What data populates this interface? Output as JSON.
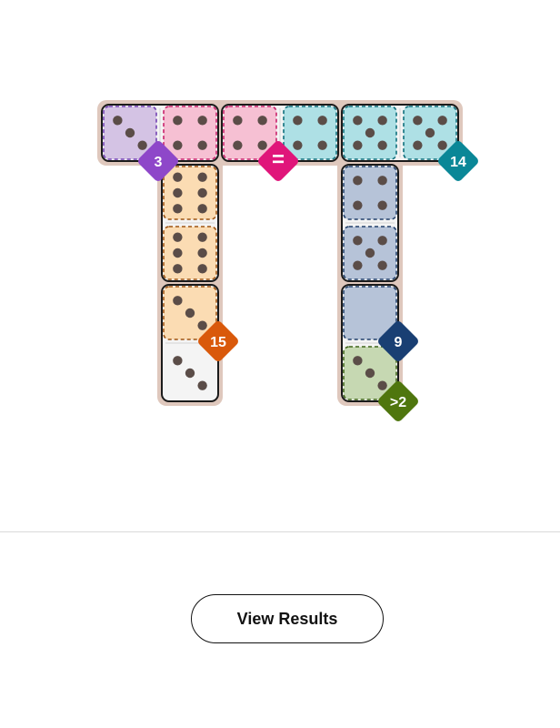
{
  "colors": {
    "tray": "#dfc8bd",
    "tile_border": "#1b1b1b",
    "pip": "#5b4d48",
    "regions": {
      "purple": {
        "fill": "#d4c3e4",
        "stroke": "#7342b3",
        "badge": "#8e47c9"
      },
      "pink": {
        "fill": "#f6c0d3",
        "stroke": "#c9226c",
        "badge": "#e0157a"
      },
      "cyan": {
        "fill": "#aee0e5",
        "stroke": "#0f6f7c",
        "badge": "#0a8797"
      },
      "orange": {
        "fill": "#fbdcb3",
        "stroke": "#9e5413",
        "badge": "#d9590b"
      },
      "slate": {
        "fill": "#b6c3d8",
        "stroke": "#22406b",
        "badge": "#193f73"
      },
      "green": {
        "fill": "#c6d8b2",
        "stroke": "#3f6419",
        "badge": "#4f760e"
      },
      "none": {
        "fill": "#f4f4f4",
        "stroke": "#1b1b1b",
        "badge": "#000000"
      }
    }
  },
  "board": {
    "cells": [
      {
        "id": "r0c0",
        "region": "purple",
        "pips": 3
      },
      {
        "id": "r0c1",
        "region": "pink",
        "pips": 4
      },
      {
        "id": "r0c2",
        "region": "pink",
        "pips": 4
      },
      {
        "id": "r0c3",
        "region": "cyan",
        "pips": 4
      },
      {
        "id": "r0c4",
        "region": "cyan",
        "pips": 5
      },
      {
        "id": "r0c5",
        "region": "cyan",
        "pips": 5
      },
      {
        "id": "r1c1",
        "region": "orange",
        "pips": 6
      },
      {
        "id": "r2c1",
        "region": "orange",
        "pips": 6
      },
      {
        "id": "r3c1",
        "region": "orange",
        "pips": 3
      },
      {
        "id": "r4c1",
        "region": "none",
        "pips": 3
      },
      {
        "id": "r1c4",
        "region": "slate",
        "pips": 4
      },
      {
        "id": "r2c4",
        "region": "slate",
        "pips": 5
      },
      {
        "id": "r3c4",
        "region": "slate",
        "pips": 0
      },
      {
        "id": "r4c4",
        "region": "green",
        "pips": 3
      }
    ],
    "dominoes": [
      {
        "name": "domino-top-left",
        "a": "r0c0",
        "b": "r0c1"
      },
      {
        "name": "domino-top-middle",
        "a": "r0c2",
        "b": "r0c3"
      },
      {
        "name": "domino-top-right",
        "a": "r0c4",
        "b": "r0c5"
      },
      {
        "name": "domino-left-upper",
        "a": "r1c1",
        "b": "r2c1"
      },
      {
        "name": "domino-left-lower",
        "a": "r3c1",
        "b": "r4c1"
      },
      {
        "name": "domino-right-upper",
        "a": "r1c4",
        "b": "r2c4"
      },
      {
        "name": "domino-right-lower",
        "a": "r3c4",
        "b": "r4c4"
      }
    ],
    "badges": [
      {
        "name": "purple-region-sum-badge",
        "label": "3",
        "region": "purple",
        "anchor": "r0c0"
      },
      {
        "name": "pink-region-equal-badge",
        "label": "=",
        "region": "pink",
        "anchor": "r0c2"
      },
      {
        "name": "cyan-region-sum-badge",
        "label": "14",
        "region": "cyan",
        "anchor": "r0c5"
      },
      {
        "name": "orange-region-sum-badge",
        "label": "15",
        "region": "orange",
        "anchor": "r3c1"
      },
      {
        "name": "slate-region-sum-badge",
        "label": "9",
        "region": "slate",
        "anchor": "r3c4"
      },
      {
        "name": "green-region-greater-badge",
        "label": ">2",
        "region": "green",
        "anchor": "r4c4"
      }
    ]
  },
  "actions": {
    "view_results_label": "View Results"
  }
}
